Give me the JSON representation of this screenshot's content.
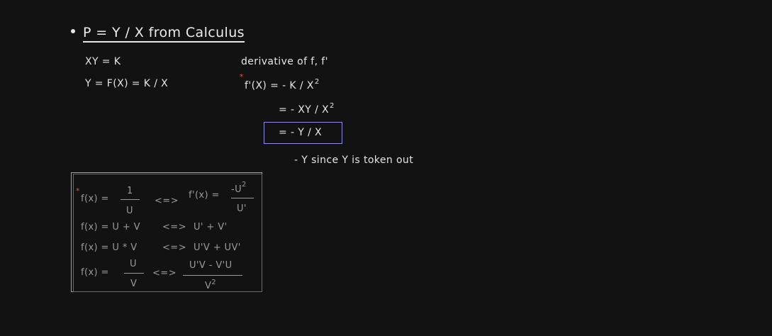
{
  "title": "P = Y / X from Calculus",
  "left_equations": {
    "line1": "XY = K",
    "line2": "Y = F(X) = K / X"
  },
  "derivative": {
    "heading": "derivative of f, f'",
    "line1": "f'(X) = - K / X",
    "line1_exp": "2",
    "line2": "= - XY / X",
    "line2_exp": "2",
    "line3_boxed": "= - Y / X",
    "note": "- Y since Y is token out"
  },
  "rules_box": {
    "rule1": {
      "lhs": "f(x) =",
      "num": "1",
      "den": "U",
      "arrow": "<=>",
      "rhs_lhs": "f'(x) =",
      "rhs_num": "-U",
      "rhs_num_exp": "2",
      "rhs_den": "U'"
    },
    "rule2": {
      "lhs": "f(x) = U + V",
      "arrow": "<=>",
      "rhs": "U' + V'"
    },
    "rule3": {
      "lhs": "f(x) = U * V",
      "arrow": "<=>",
      "rhs": "U'V + UV'"
    },
    "rule4": {
      "lhs": "f(x) =",
      "num": "U",
      "den": "V",
      "arrow": "<=>",
      "rhs_num": "U'V - V'U",
      "rhs_den": "V",
      "rhs_den_exp": "2"
    }
  },
  "colors": {
    "background": "#121212",
    "ink": "#e6e6e6",
    "box_grey": "#9a9a9a",
    "box_blue": "#8a8ee8",
    "star_red": "#e5533d"
  }
}
